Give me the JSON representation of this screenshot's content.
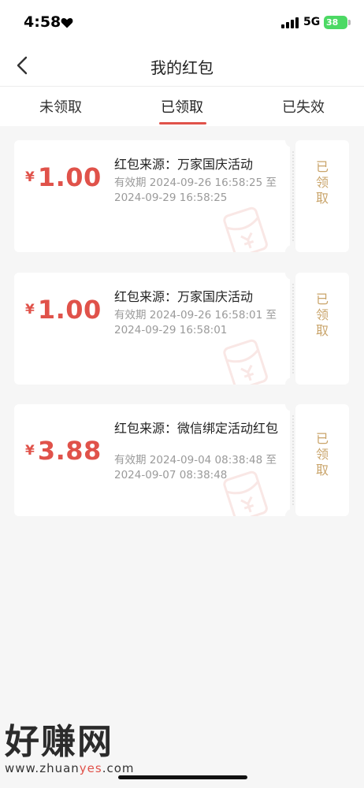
{
  "status_bar": {
    "time": "4:58",
    "network": "5G",
    "battery": "38"
  },
  "nav": {
    "title": "我的红包"
  },
  "tabs": [
    {
      "label": "未领取",
      "active": false
    },
    {
      "label": "已领取",
      "active": true
    },
    {
      "label": "已失效",
      "active": false
    }
  ],
  "coupons": [
    {
      "currency": "¥",
      "amount": "1.00",
      "source": "红包来源：万家国庆活动",
      "validity": "有效期 2024-09-26 16:58:25 至 2024-09-29 16:58:25",
      "status": "已领取"
    },
    {
      "currency": "¥",
      "amount": "1.00",
      "source": "红包来源：万家国庆活动",
      "validity": "有效期 2024-09-26 16:58:01 至 2024-09-29 16:58:01",
      "status": "已领取"
    },
    {
      "currency": "¥",
      "amount": "3.88",
      "source": "红包来源：微信绑定活动红包",
      "validity": "有效期 2024-09-04 08:38:48 至 2024-09-07 08:38:48",
      "status": "已领取"
    }
  ],
  "watermark": {
    "logo": "好赚网",
    "url_prefix": "www.zhuan",
    "url_highlight": "yes",
    "url_suffix": ".com"
  },
  "colors": {
    "accent_red": "#e0524a",
    "status_gold": "#c9a46a",
    "background": "#f6f6f6"
  }
}
